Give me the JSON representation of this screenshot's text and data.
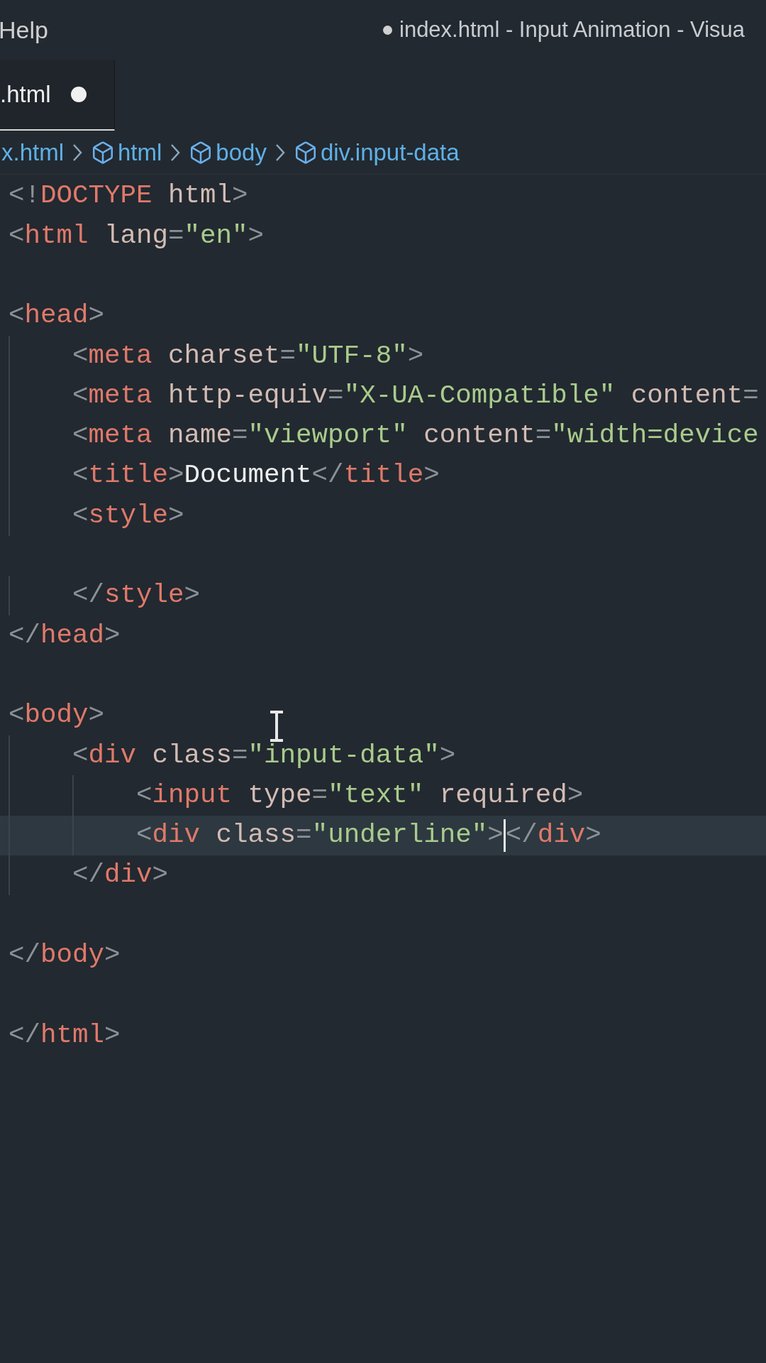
{
  "menu": {
    "items": [
      "Help"
    ]
  },
  "title_bar": {
    "title": "index.html - Input Animation - Visua",
    "modified": true
  },
  "tabs": [
    {
      "label": ".html",
      "modified": true,
      "selected": true
    }
  ],
  "breadcrumb": [
    {
      "label": "x.html",
      "kind": "file"
    },
    {
      "label": "html",
      "kind": "element"
    },
    {
      "label": "body",
      "kind": "element"
    },
    {
      "label": "div.input-data",
      "kind": "element"
    }
  ],
  "editor": {
    "lines": [
      {
        "current": false,
        "tokens": [
          {
            "kind": "punct",
            "text": "<!"
          },
          {
            "kind": "tag",
            "text": "DOCTYPE"
          },
          {
            "kind": "attr",
            "text": " html"
          },
          {
            "kind": "punct",
            "text": ">"
          }
        ]
      },
      {
        "current": false,
        "tokens": [
          {
            "kind": "punct",
            "text": "<"
          },
          {
            "kind": "tag",
            "text": "html"
          },
          {
            "kind": "attr",
            "text": " lang"
          },
          {
            "kind": "punct",
            "text": "="
          },
          {
            "kind": "str",
            "text": "\"en\""
          },
          {
            "kind": "punct",
            "text": ">"
          }
        ]
      },
      {
        "current": false
      },
      {
        "current": false,
        "tokens": [
          {
            "kind": "punct",
            "text": "<"
          },
          {
            "kind": "tag",
            "text": "head"
          },
          {
            "kind": "punct",
            "text": ">"
          }
        ]
      },
      {
        "current": false,
        "tokens": [
          {
            "kind": "punct",
            "text": "    <"
          },
          {
            "kind": "tag",
            "text": "meta"
          },
          {
            "kind": "attr",
            "text": " charset"
          },
          {
            "kind": "punct",
            "text": "="
          },
          {
            "kind": "str",
            "text": "\"UTF-8\""
          },
          {
            "kind": "punct",
            "text": ">"
          }
        ]
      },
      {
        "current": false,
        "tokens": [
          {
            "kind": "punct",
            "text": "    <"
          },
          {
            "kind": "tag",
            "text": "meta"
          },
          {
            "kind": "attr",
            "text": " http-equiv"
          },
          {
            "kind": "punct",
            "text": "="
          },
          {
            "kind": "str",
            "text": "\"X-UA-Compatible\""
          },
          {
            "kind": "attr",
            "text": " content"
          },
          {
            "kind": "punct",
            "text": "="
          }
        ]
      },
      {
        "current": false,
        "tokens": [
          {
            "kind": "punct",
            "text": "    <"
          },
          {
            "kind": "tag",
            "text": "meta"
          },
          {
            "kind": "attr",
            "text": " name"
          },
          {
            "kind": "punct",
            "text": "="
          },
          {
            "kind": "str",
            "text": "\"viewport\""
          },
          {
            "kind": "attr",
            "text": " content"
          },
          {
            "kind": "punct",
            "text": "="
          },
          {
            "kind": "str",
            "text": "\"width=device"
          }
        ]
      },
      {
        "current": false,
        "tokens": [
          {
            "kind": "punct",
            "text": "    <"
          },
          {
            "kind": "tag",
            "text": "title"
          },
          {
            "kind": "punct",
            "text": ">"
          },
          {
            "kind": "text",
            "text": "Document"
          },
          {
            "kind": "punct",
            "text": "</"
          },
          {
            "kind": "tag",
            "text": "title"
          },
          {
            "kind": "punct",
            "text": ">"
          }
        ]
      },
      {
        "current": false,
        "tokens": [
          {
            "kind": "punct",
            "text": "    <"
          },
          {
            "kind": "tag",
            "text": "style"
          },
          {
            "kind": "punct",
            "text": ">"
          }
        ]
      },
      {
        "current": false
      },
      {
        "current": false,
        "tokens": [
          {
            "kind": "punct",
            "text": "    </"
          },
          {
            "kind": "tag",
            "text": "style"
          },
          {
            "kind": "punct",
            "text": ">"
          }
        ]
      },
      {
        "current": false,
        "tokens": [
          {
            "kind": "punct",
            "text": "</"
          },
          {
            "kind": "tag",
            "text": "head"
          },
          {
            "kind": "punct",
            "text": ">"
          }
        ]
      },
      {
        "current": false
      },
      {
        "current": false,
        "tokens": [
          {
            "kind": "punct",
            "text": "<"
          },
          {
            "kind": "tag",
            "text": "body"
          },
          {
            "kind": "punct",
            "text": ">"
          }
        ]
      },
      {
        "current": false,
        "tokens": [
          {
            "kind": "punct",
            "text": "    <"
          },
          {
            "kind": "tag",
            "text": "div"
          },
          {
            "kind": "attr",
            "text": " class"
          },
          {
            "kind": "punct",
            "text": "="
          },
          {
            "kind": "str",
            "text": "\"input-data\""
          },
          {
            "kind": "punct",
            "text": ">"
          }
        ]
      },
      {
        "current": false,
        "tokens": [
          {
            "kind": "punct",
            "text": "        <"
          },
          {
            "kind": "tag",
            "text": "input"
          },
          {
            "kind": "attr",
            "text": " type"
          },
          {
            "kind": "punct",
            "text": "="
          },
          {
            "kind": "str",
            "text": "\"text\""
          },
          {
            "kind": "attr",
            "text": " required"
          },
          {
            "kind": "punct",
            "text": ">"
          }
        ]
      },
      {
        "current": true,
        "tokens": [
          {
            "kind": "punct",
            "text": "        <"
          },
          {
            "kind": "tag",
            "text": "div"
          },
          {
            "kind": "attr",
            "text": " class"
          },
          {
            "kind": "punct",
            "text": "="
          },
          {
            "kind": "str",
            "text": "\"underline\""
          },
          {
            "kind": "punct",
            "text": ">"
          },
          {
            "kind": "caret"
          },
          {
            "kind": "punct",
            "text": "</"
          },
          {
            "kind": "tag",
            "text": "div"
          },
          {
            "kind": "punct",
            "text": ">"
          }
        ]
      },
      {
        "current": false,
        "tokens": [
          {
            "kind": "punct",
            "text": "    </"
          },
          {
            "kind": "tag",
            "text": "div"
          },
          {
            "kind": "punct",
            "text": ">"
          }
        ]
      },
      {
        "current": false
      },
      {
        "current": false,
        "tokens": [
          {
            "kind": "punct",
            "text": "</"
          },
          {
            "kind": "tag",
            "text": "body"
          },
          {
            "kind": "punct",
            "text": ">"
          }
        ]
      },
      {
        "current": false
      },
      {
        "current": false,
        "tokens": [
          {
            "kind": "punct",
            "text": "</"
          },
          {
            "kind": "tag",
            "text": "html"
          },
          {
            "kind": "punct",
            "text": ">"
          }
        ]
      }
    ]
  }
}
